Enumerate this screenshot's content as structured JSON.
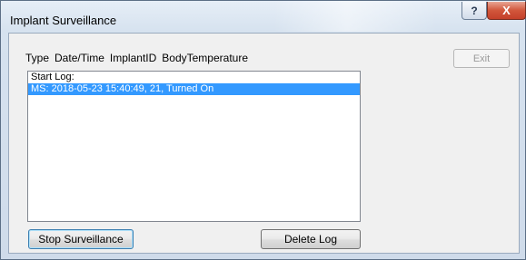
{
  "window": {
    "title": "Implant Surveillance",
    "help_glyph": "?",
    "close_glyph": "X"
  },
  "header": {
    "columns": [
      "Type",
      "Date/Time",
      "ImplantID",
      "BodyTemperature"
    ]
  },
  "buttons": {
    "exit_label": "Exit",
    "stop_label": "Stop Surveillance",
    "delete_label": "Delete Log"
  },
  "log": {
    "items": [
      {
        "text": "Start Log:",
        "selected": false
      },
      {
        "text": "MS: 2018-05-23 15:40:49, 21, Turned On",
        "selected": true
      }
    ]
  },
  "colors": {
    "selection": "#3399ff",
    "close_button": "#c4402a"
  }
}
